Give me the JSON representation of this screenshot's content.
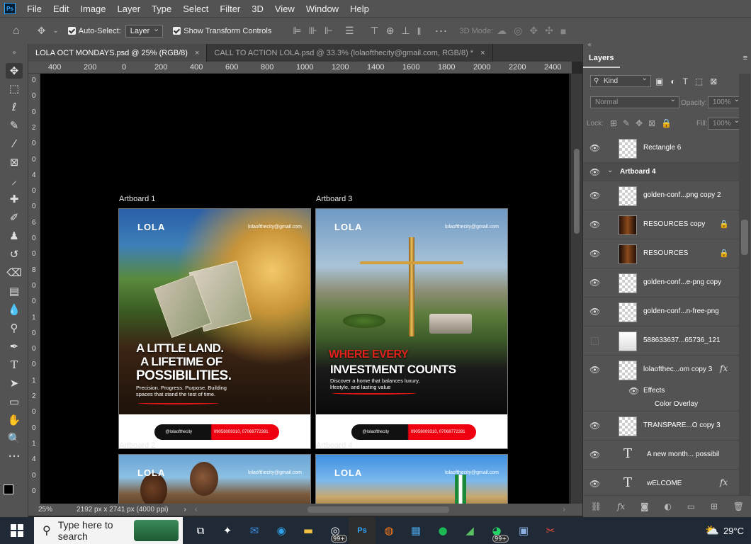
{
  "app": {
    "logo": "Ps"
  },
  "menu": [
    "File",
    "Edit",
    "Image",
    "Layer",
    "Type",
    "Select",
    "Filter",
    "3D",
    "View",
    "Window",
    "Help"
  ],
  "options": {
    "auto_select_label": "Auto-Select:",
    "layer_select": "Layer",
    "transform_label": "Show Transform Controls",
    "mode_3d": "3D Mode:"
  },
  "tabs": [
    {
      "label": "LOLA OCT MONDAYS.psd @ 25% (RGB/8)",
      "close": "×"
    },
    {
      "label": "CALL TO ACTION LOLA.psd @ 33.3% (lolaofthecity@gmail.com, RGB/8) *",
      "close": "×"
    }
  ],
  "ruler_top": [
    "400",
    "200",
    "0",
    "200",
    "400",
    "600",
    "800",
    "1000",
    "1200",
    "1400",
    "1600",
    "1800",
    "2000",
    "2200",
    "2400"
  ],
  "ruler_left": [
    "0",
    "0",
    "0",
    "2",
    "0",
    "0",
    "4",
    "0",
    "0",
    "6",
    "0",
    "0",
    "8",
    "0",
    "0",
    "1",
    "0",
    "0",
    "0",
    "1",
    "2",
    "0",
    "0",
    "1",
    "4",
    "0",
    "0"
  ],
  "artboards": {
    "a1": {
      "label": "Artboard 1",
      "logo": "LOLA",
      "email": "lolaofthecity@gmail.com",
      "headline": [
        "A LITTLE LAND.",
        "A LIFETIME OF",
        "POSSIBILITIES."
      ],
      "subline": "Precision. Progress. Purpose. Building spaces that stand the test of time.",
      "handle": "@lolaofthecity",
      "phone": "09058009310, 07068772391"
    },
    "a3": {
      "label": "Artboard 3",
      "logo": "LOLA",
      "email": "lolaofthecity@gmail.com",
      "headline_red": "WHERE EVERY",
      "headline_white": "INVESTMENT COUNTS",
      "subline": "Discover a home that balances luxury, lifestyle, and lasting value",
      "handle": "@lolaofthecity",
      "phone": "09058009310, 07068772391"
    },
    "a2": {
      "label": "Artboard 2",
      "logo": "LOLA",
      "email": "lolaofthecity@gmail.com"
    },
    "a4": {
      "label": "Artboard 4",
      "logo": "LOLA",
      "email": "lolaofthecity@gmail.com"
    }
  },
  "status": {
    "zoom": "25%",
    "dims": "2192 px x 2741 px (4000 ppi)"
  },
  "layers_panel": {
    "title": "Layers",
    "filter": "Kind",
    "blend": "Normal",
    "opacity_label": "Opacity:",
    "opacity": "100%",
    "lock_label": "Lock:",
    "fill_label": "Fill:",
    "fill": "100%",
    "rows": [
      {
        "name": "Rectangle 6",
        "visible": true
      },
      {
        "name": "Artboard 4",
        "group": true
      },
      {
        "name": "golden-conf...png copy 2",
        "visible": true
      },
      {
        "name": "RESOURCES  copy",
        "visible": true,
        "locked": true
      },
      {
        "name": "RESOURCES",
        "visible": true,
        "locked": true
      },
      {
        "name": "golden-conf...e-png copy",
        "visible": true
      },
      {
        "name": "golden-conf...n-free-png",
        "visible": true
      },
      {
        "name": "588633637...65736_121",
        "visible": false
      },
      {
        "name": "lolaofthec...om copy 3",
        "visible": true,
        "fx": "fx"
      },
      {
        "name": "Effects"
      },
      {
        "name": "Color Overlay"
      },
      {
        "name": "TRANSPARE...O  copy 3",
        "visible": true
      },
      {
        "name": "A new month...  possibil",
        "visible": true,
        "type": "T"
      },
      {
        "name": "wELCOME",
        "visible": true,
        "type": "T",
        "fx": "fx"
      }
    ]
  },
  "taskbar": {
    "search_placeholder": "Type here to search",
    "badge": "99+",
    "badge2": "99+",
    "temperature": "29°C"
  }
}
